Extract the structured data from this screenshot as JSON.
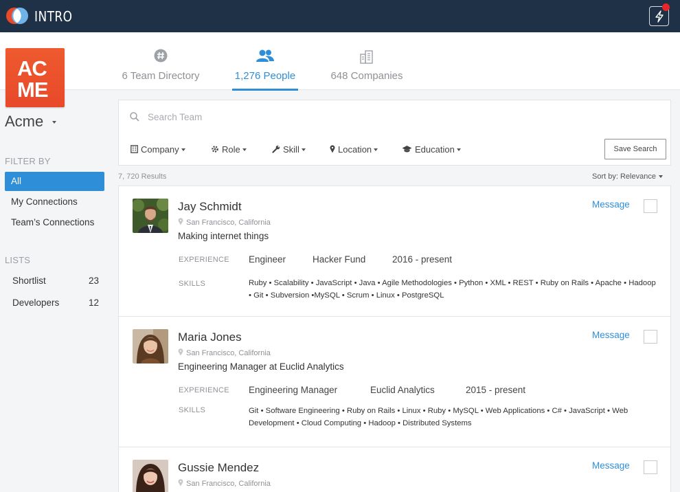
{
  "app": {
    "name": "INTRO"
  },
  "org": {
    "name": "Acme",
    "logo_line1": "AC",
    "logo_line2": "ME"
  },
  "tabs": [
    {
      "label": "6 Team Directory",
      "icon": "hashtag-icon",
      "active": false
    },
    {
      "label": "1,276 People",
      "icon": "people-icon",
      "active": true
    },
    {
      "label": "648 Companies",
      "icon": "buildings-icon",
      "active": false
    }
  ],
  "sidebar": {
    "filter_heading": "FILTER BY",
    "filters": [
      {
        "label": "All",
        "active": true
      },
      {
        "label": "My Connections",
        "active": false
      },
      {
        "label": "Team’s Connections",
        "active": false
      }
    ],
    "lists_heading": "LISTS",
    "lists": [
      {
        "label": "Shortlist",
        "count": "23"
      },
      {
        "label": "Developers",
        "count": "12"
      }
    ]
  },
  "search": {
    "placeholder": "Search Team",
    "value": ""
  },
  "filters": {
    "company": "Company",
    "role": "Role",
    "skill": "Skill",
    "location": "Location",
    "education": "Education",
    "save_search": "Save Search"
  },
  "results": {
    "count_text": "7, 720 Results",
    "sort_text": "Sort by: Relevance"
  },
  "people": [
    {
      "name": "Jay Schmidt",
      "location": "San Francisco, California",
      "headline": "Making internet things",
      "experience_label": "EXPERIENCE",
      "role": "Engineer",
      "company": "Hacker Fund",
      "period": "2016 - present",
      "skills_label": "SKILLS",
      "skills": "Ruby • Scalability • JavaScript • Java • Agile Methodologies • Python • XML • REST • Ruby on Rails • Apache • Hadoop • Git • Subversion •MySQL • Scrum • Linux • PostgreSQL",
      "message_label": "Message"
    },
    {
      "name": "Maria Jones",
      "location": "San Francisco, California",
      "headline": "Engineering Manager at Euclid Analytics",
      "experience_label": "EXPERIENCE",
      "role": "Engineering Manager",
      "company": "Euclid Analytics",
      "period": "2015 - present",
      "skills_label": "SKILLS",
      "skills": "Git • Software Engineering • Ruby on Rails • Linux • Ruby • MySQL • Web Applications • C# • JavaScript • Web Development • Cloud Computing • Hadoop • Distributed Systems",
      "message_label": "Message"
    },
    {
      "name": "Gussie Mendez",
      "location": "San Francisco, California",
      "message_label": "Message"
    }
  ],
  "colors": {
    "topbar": "#1f3147",
    "accent": "#2f8ed8",
    "logo": "#e8492a",
    "notification": "#e8262a"
  }
}
